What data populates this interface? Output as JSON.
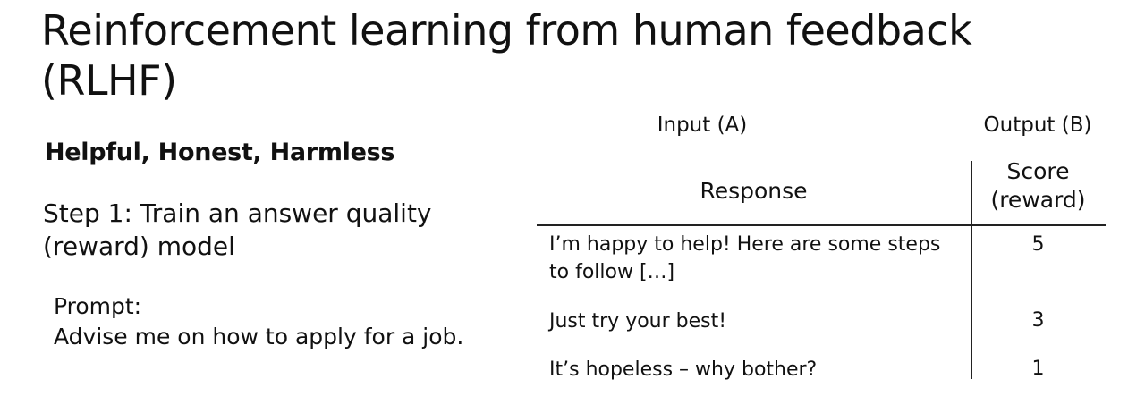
{
  "title": "Reinforcement learning from human feedback (RLHF)",
  "subtitle": "Helpful, Honest, Harmless",
  "step": "Step 1: Train an answer quality (reward) model",
  "prompt": {
    "label": "Prompt:",
    "text": "Advise me on how to apply for a job."
  },
  "table": {
    "input_label": "Input (A)",
    "output_label": "Output (B)",
    "col_response": "Response",
    "col_score_line1": "Score",
    "col_score_line2": "(reward)",
    "rows": [
      {
        "response": "I’m happy to help! Here are some steps to follow […]",
        "score": "5"
      },
      {
        "response": "Just try your best!",
        "score": "3"
      },
      {
        "response": "It’s hopeless – why bother?",
        "score": "1"
      }
    ]
  }
}
